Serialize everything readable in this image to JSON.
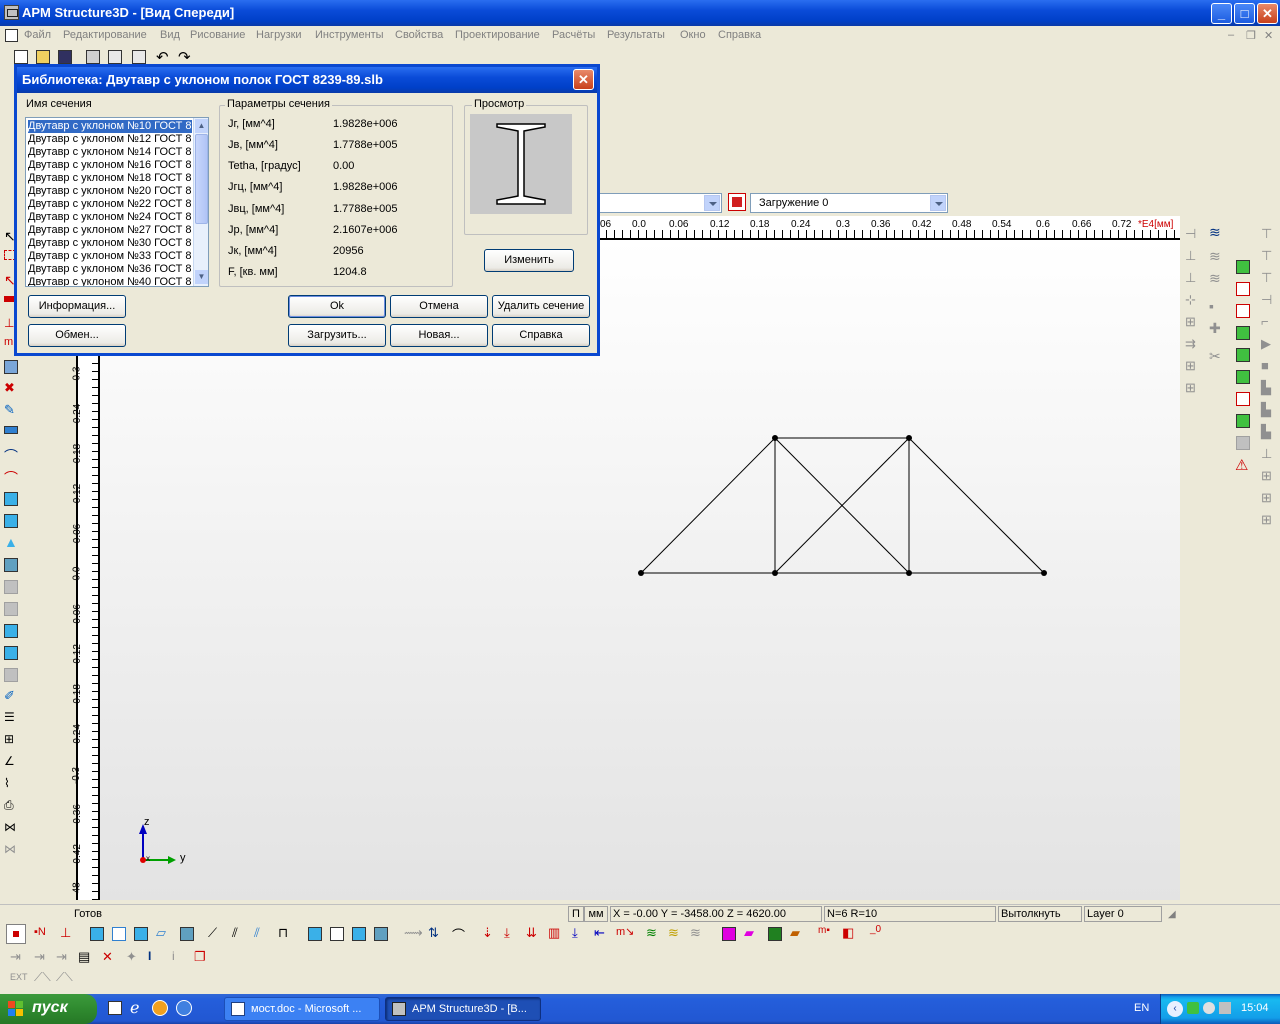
{
  "window": {
    "title": "APM Structure3D - [Вид Спереди]",
    "buttons": [
      "minimize-icon",
      "maximize-icon",
      "close-icon"
    ]
  },
  "menu": [
    "Файл",
    "Редактирование",
    "Вид",
    "Рисование",
    "Нагрузки",
    "Инструменты",
    "Свойства",
    "Проектирование",
    "Расчёты",
    "Результаты",
    "Окно",
    "Справка"
  ],
  "load_combo": {
    "value": "Загружение 0"
  },
  "dialog": {
    "title": "Библиотека: Двутавр с уклоном полок ГОСТ 8239-89.slb",
    "section_name_label": "Имя сечения",
    "sections": [
      "Двутавр с уклоном  №10 ГОСТ 8",
      "Двутавр с уклоном  №12 ГОСТ 8",
      "Двутавр с уклоном  №14 ГОСТ 8",
      "Двутавр с уклоном  №16 ГОСТ 8",
      "Двутавр с уклоном  №18 ГОСТ 8",
      "Двутавр с уклоном  №20 ГОСТ 8",
      "Двутавр с уклоном  №22 ГОСТ 8",
      "Двутавр с уклоном  №24 ГОСТ 8",
      "Двутавр с уклоном  №27 ГОСТ 8",
      "Двутавр с уклоном  №30 ГОСТ 8",
      "Двутавр с уклоном  №33 ГОСТ 8",
      "Двутавр с уклоном  №36 ГОСТ 8",
      "Двутавр с уклоном  №40 ГОСТ 8"
    ],
    "params_label": "Параметры сечения",
    "params": [
      {
        "name": "Jг, [мм^4]",
        "value": "1.9828e+006"
      },
      {
        "name": "Jв, [мм^4]",
        "value": "1.7788e+005"
      },
      {
        "name": "Tetha, [градус]",
        "value": "0.00"
      },
      {
        "name": "Jгц, [мм^4]",
        "value": "1.9828e+006"
      },
      {
        "name": "Jвц, [мм^4]",
        "value": "1.7788e+005"
      },
      {
        "name": "Jp, [мм^4]",
        "value": "2.1607e+006"
      },
      {
        "name": "Jк, [мм^4]",
        "value": "20956"
      },
      {
        "name": "F, [кв. мм]",
        "value": "1204.8"
      }
    ],
    "preview_label": "Просмотр",
    "change_btn": "Изменить",
    "buttons": {
      "info": "Информация...",
      "exchange": "Обмен...",
      "ok": "Ok",
      "cancel": "Отмена",
      "delete": "Удалить сечение",
      "load": "Загрузить...",
      "new": "Новая...",
      "help": "Справка"
    }
  },
  "ruler_top": {
    "ticks": [
      "06",
      "0.0",
      "0.06",
      "0.12",
      "0.18",
      "0.24",
      "0.3",
      "0.36",
      "0.42",
      "0.48",
      "0.54",
      "0.6",
      "0.66",
      "0.72"
    ],
    "unit": "*E4[мм]"
  },
  "ruler_left": {
    "ticks": [
      "0.3",
      "0.24",
      "0.18",
      "0.12",
      "0.06",
      "0.0",
      "-0.06",
      "-0.12",
      "-0.18",
      "-0.24",
      "-0.3",
      "-0.36",
      "-0.42",
      "-48"
    ]
  },
  "axes": {
    "z": "z",
    "y": "y",
    "x": "x"
  },
  "status": {
    "ready": "Готов",
    "mode1": "П",
    "mode2": "мм",
    "coords": "X = -0.00 Y = -3458.00 Z = 4620.00",
    "counts": "N=6 R=10",
    "action": "Вытолкнуть",
    "layer": "Layer 0"
  },
  "taskbar": {
    "start": "пуск",
    "tasks": [
      "мост.doc - Microsoft ...",
      "APM Structure3D - [В..."
    ],
    "lang": "EN",
    "clock": "15:04"
  }
}
